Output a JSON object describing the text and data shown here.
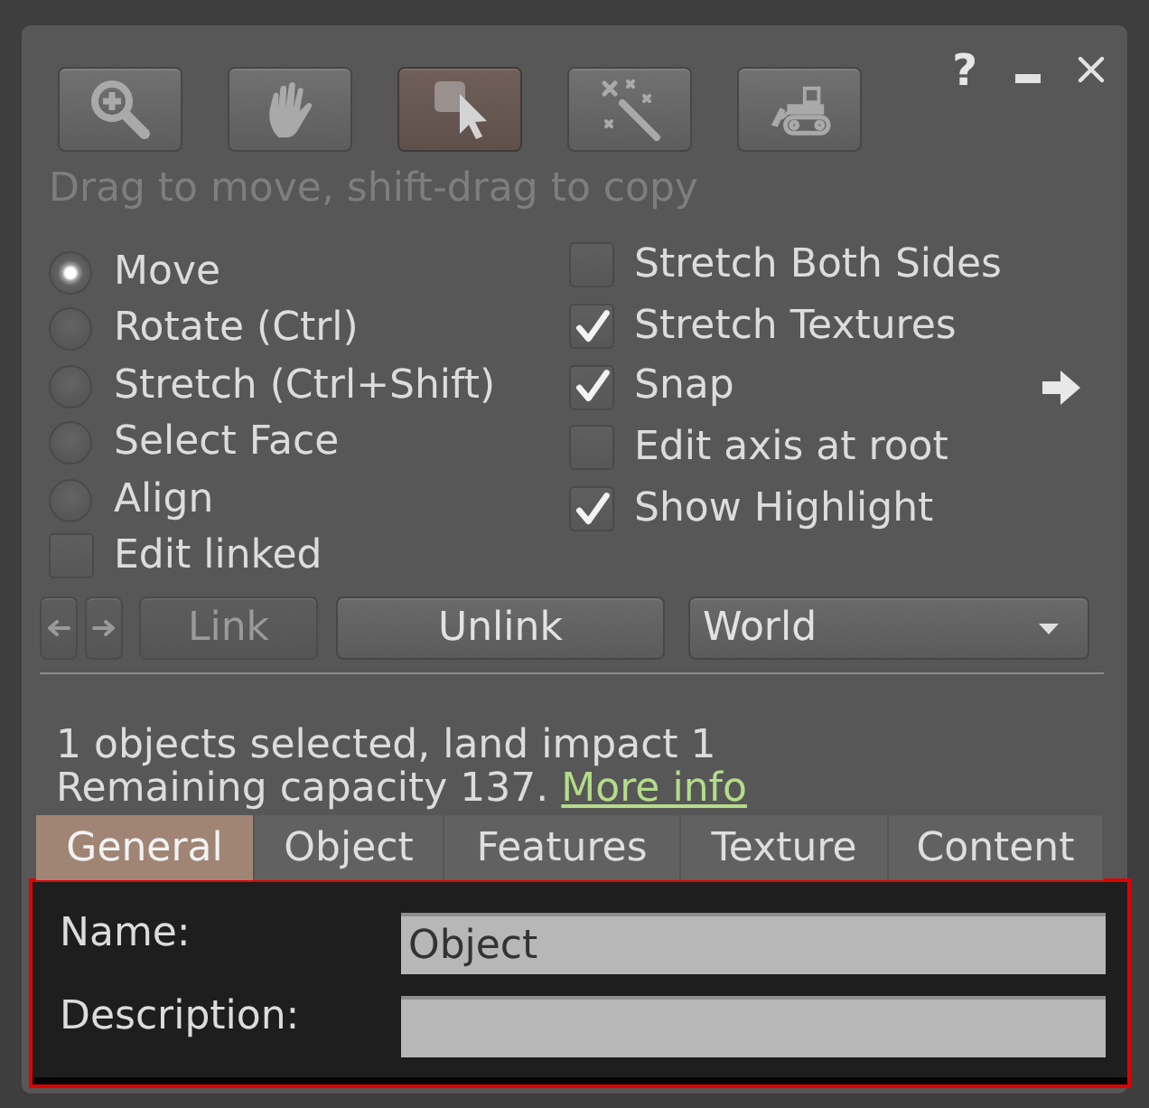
{
  "title_bar": {
    "help_label": "?"
  },
  "toolbar": {
    "tools": [
      {
        "kind": "zoom",
        "selected": false
      },
      {
        "kind": "grab",
        "selected": false
      },
      {
        "kind": "select",
        "selected": true
      },
      {
        "kind": "create",
        "selected": false
      },
      {
        "kind": "land",
        "selected": false
      }
    ],
    "hint": "Drag to move, shift-drag to copy"
  },
  "modes": [
    {
      "label": "Move",
      "selected": true
    },
    {
      "label": "Rotate (Ctrl)",
      "selected": false
    },
    {
      "label": "Stretch (Ctrl+Shift)",
      "selected": false
    },
    {
      "label": "Select Face",
      "selected": false
    },
    {
      "label": "Align",
      "selected": false
    }
  ],
  "edit_linked": {
    "label": "Edit linked",
    "checked": false
  },
  "options": [
    {
      "kind": "plain",
      "label": "Stretch Both Sides",
      "checked": false
    },
    {
      "kind": "plain",
      "label": "Stretch Textures",
      "checked": true
    },
    {
      "kind": "arrow",
      "label": "Snap",
      "checked": true
    },
    {
      "kind": "plain",
      "label": "Edit axis at root",
      "checked": false
    },
    {
      "kind": "plain",
      "label": "Show Highlight",
      "checked": true
    }
  ],
  "link_controls": [
    {
      "kind": "prev",
      "disabled": true
    },
    {
      "kind": "next",
      "disabled": true
    },
    {
      "kind": "text",
      "label": "Link",
      "disabled": true
    },
    {
      "kind": "text",
      "label": "Unlink",
      "disabled": false
    }
  ],
  "reference_dropdown": {
    "value": "World"
  },
  "selection_info": {
    "summary": "1 objects selected, land impact 1",
    "capacity": "Remaining capacity 137.",
    "link": "More info"
  },
  "tabs": [
    {
      "label": "General",
      "selected": true
    },
    {
      "label": "Object",
      "selected": false
    },
    {
      "label": "Features",
      "selected": false
    },
    {
      "label": "Texture",
      "selected": false
    },
    {
      "label": "Content",
      "selected": false
    }
  ],
  "general_tab": {
    "highlighted": true,
    "fields": [
      {
        "label": "Name:",
        "value": "Object"
      },
      {
        "label": "Description:"
      }
    ]
  }
}
